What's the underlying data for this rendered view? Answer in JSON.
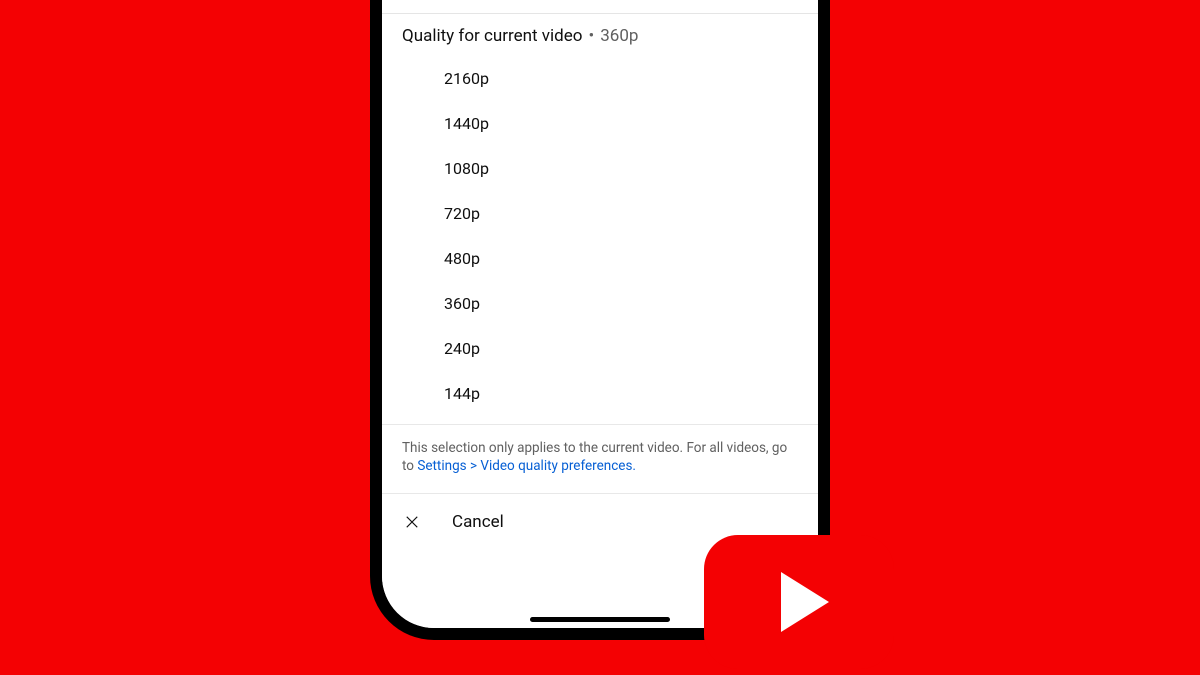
{
  "sheet": {
    "title": "Quality for current video",
    "separator": "•",
    "current_quality": "360p",
    "options": [
      "2160p",
      "1440p",
      "1080p",
      "720p",
      "480p",
      "360p",
      "240p",
      "144p"
    ],
    "note_prefix": "This selection only applies to the current video. For all videos, go to ",
    "note_link": "Settings > Video quality preferences.",
    "cancel_label": "Cancel"
  }
}
